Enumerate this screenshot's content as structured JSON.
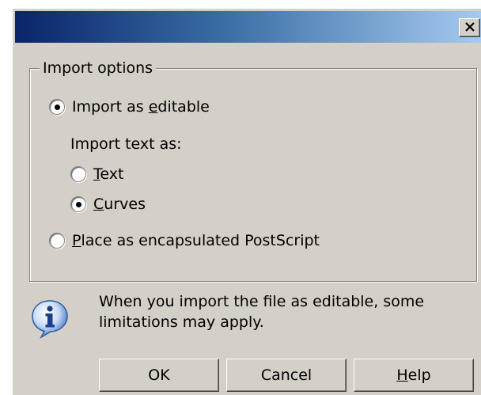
{
  "window": {
    "close_icon": "close-x-icon"
  },
  "import_options": {
    "group_label": "Import options",
    "import_editable": {
      "label_before": "Import as ",
      "label_mnemonic": "e",
      "label_after": "ditable",
      "selected": true
    },
    "import_text_as_label": "Import text as:",
    "text_option": {
      "label_before": "",
      "label_mnemonic": "T",
      "label_after": "ext",
      "selected": false
    },
    "curves_option": {
      "label_before": "",
      "label_mnemonic": "C",
      "label_after": "urves",
      "selected": true
    },
    "place_eps": {
      "label_before": "",
      "label_mnemonic": "P",
      "label_after": "lace as encapsulated PostScript",
      "selected": false
    }
  },
  "info": {
    "icon": "info-icon",
    "message_line1": "When you import the file as editable, some",
    "message_line2": "limitations may apply."
  },
  "buttons": {
    "ok_label": "OK",
    "cancel_label": "Cancel",
    "help_before": "",
    "help_mnemonic": "H",
    "help_after": "elp"
  }
}
